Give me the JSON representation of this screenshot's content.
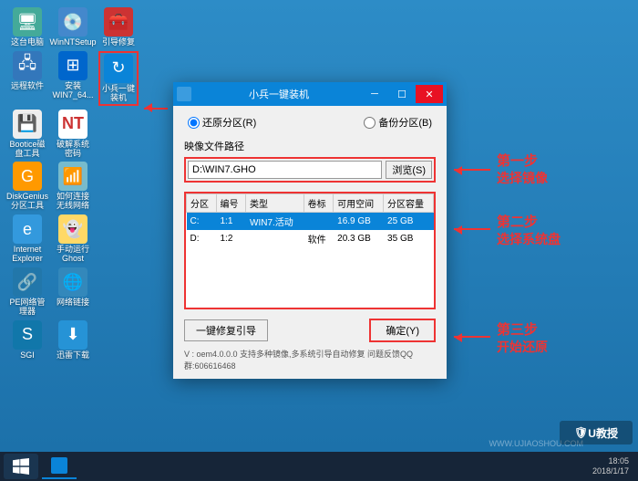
{
  "desktop_icons": {
    "row0": [
      "这台电脑",
      "WinNTSetup",
      "引导修复"
    ],
    "row1": [
      "远程软件",
      "安装WIN7_64...",
      "小兵一键装机"
    ],
    "row2": [
      "Bootice磁盘工具",
      "破解系统密码"
    ],
    "row3": [
      "DiskGenius分区工具",
      "如何连接无线网络"
    ],
    "row4": [
      "Internet Explorer",
      "手动运行Ghost"
    ],
    "row5": [
      "PE网络管理器",
      "网络链接"
    ],
    "row6": [
      "SGI",
      "迅雷下载"
    ]
  },
  "window": {
    "title": "小兵一键装机",
    "radio_restore": "还原分区(R)",
    "radio_backup": "备份分区(B)",
    "path_label": "映像文件路径",
    "path_value": "D:\\WIN7.GHO",
    "browse": "浏览(S)",
    "columns": [
      "分区",
      "编号",
      "类型",
      "卷标",
      "可用空间",
      "分区容量"
    ],
    "rows": [
      {
        "part": "C:",
        "idx": "1:1",
        "type": "WIN7.活动",
        "vol": "",
        "free": "16.9 GB",
        "cap": "25 GB",
        "selected": true
      },
      {
        "part": "D:",
        "idx": "1:2",
        "type": "",
        "vol": "软件",
        "free": "20.3 GB",
        "cap": "35 GB",
        "selected": false
      }
    ],
    "repair": "一键修复引导",
    "ok": "确定(Y)",
    "status": "V : oem4.0.0.0       支持多种镜像,多系统引导自动修复 问题反馈QQ群:606616468"
  },
  "annotations": {
    "step1_t": "第一步",
    "step1_s": "选择镜像",
    "step2_t": "第二步",
    "step2_s": "选择系统盘",
    "step3_t": "第三步",
    "step3_s": "开始还原"
  },
  "tray": {
    "time": "18:05",
    "date": "2018/1/17"
  },
  "watermark": "WWW.UJIAOSHOU.COM",
  "logo": "U教授"
}
